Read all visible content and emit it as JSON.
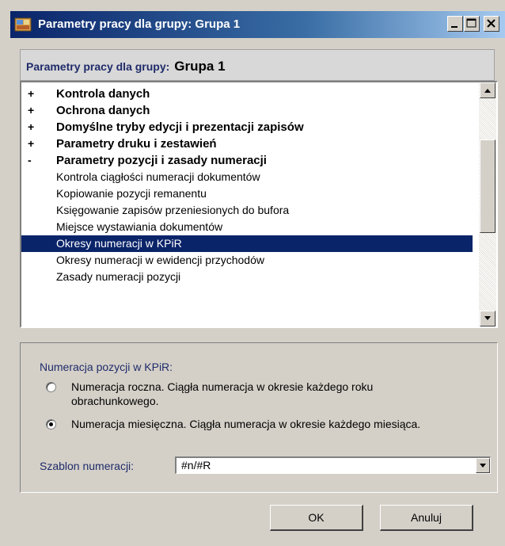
{
  "window": {
    "title": "Parametry pracy dla grupy: Grupa 1"
  },
  "header": {
    "label": "Parametry pracy dla grupy:",
    "group": "Grupa 1"
  },
  "tree": {
    "items": [
      {
        "sign": "+",
        "label": "Kontrola danych"
      },
      {
        "sign": "+",
        "label": "Ochrona danych"
      },
      {
        "sign": "+",
        "label": "Domyślne tryby edycji i prezentacji zapisów"
      },
      {
        "sign": "+",
        "label": "Parametry druku i zestawień"
      },
      {
        "sign": "-",
        "label": "Parametry pozycji i zasady numeracji"
      },
      {
        "label": "Kontrola ciągłości numeracji dokumentów"
      },
      {
        "label": "Kopiowanie pozycji remanentu"
      },
      {
        "label": "Księgowanie zapisów przeniesionych do bufora"
      },
      {
        "label": "Miejsce wystawiania dokumentów"
      },
      {
        "label": "Okresy numeracji w KPiR",
        "selected": true
      },
      {
        "label": "Okresy numeracji w ewidencji przychodów"
      },
      {
        "label": "Zasady numeracji pozycji"
      }
    ]
  },
  "options": {
    "title": "Numeracja pozycji w KPiR:",
    "radio_yearly": "Numeracja roczna. Ciągła numeracja w okresie każdego roku obrachunkowego.",
    "radio_monthly": "Numeracja miesięczna. Ciągła numeracja w okresie każdego miesiąca.",
    "selected_radio": "monthly",
    "template_label": "Szablon numeracji:",
    "template_value": "#n/#R"
  },
  "buttons": {
    "ok": "OK",
    "cancel": "Anuluj"
  },
  "icons": {
    "app": "app-icon",
    "minimize": "minimize-icon",
    "maximize": "maximize-icon",
    "close": "close-icon"
  }
}
